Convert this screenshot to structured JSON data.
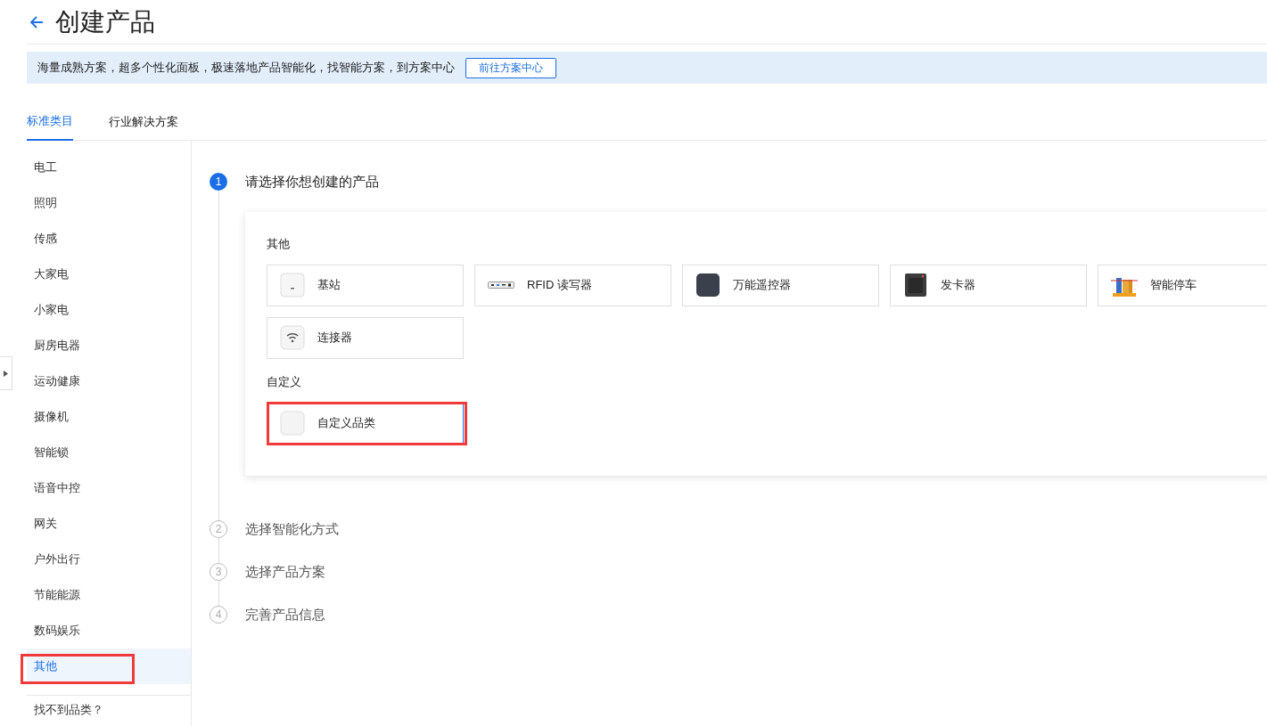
{
  "header": {
    "title": "创建产品"
  },
  "banner": {
    "text": "海量成熟方案，超多个性化面板，极速落地产品智能化，找智能方案，到方案中心",
    "button": "前往方案中心"
  },
  "tabs": [
    {
      "label": "标准类目",
      "selected": true
    },
    {
      "label": "行业解决方案",
      "selected": false
    }
  ],
  "sidebar": {
    "items": [
      {
        "label": "电工",
        "selected": false,
        "highlighted": false
      },
      {
        "label": "照明",
        "selected": false,
        "highlighted": false
      },
      {
        "label": "传感",
        "selected": false,
        "highlighted": false
      },
      {
        "label": "大家电",
        "selected": false,
        "highlighted": false
      },
      {
        "label": "小家电",
        "selected": false,
        "highlighted": false
      },
      {
        "label": "厨房电器",
        "selected": false,
        "highlighted": false
      },
      {
        "label": "运动健康",
        "selected": false,
        "highlighted": false
      },
      {
        "label": "摄像机",
        "selected": false,
        "highlighted": false
      },
      {
        "label": "智能锁",
        "selected": false,
        "highlighted": false
      },
      {
        "label": "语音中控",
        "selected": false,
        "highlighted": false
      },
      {
        "label": "网关",
        "selected": false,
        "highlighted": false
      },
      {
        "label": "户外出行",
        "selected": false,
        "highlighted": false
      },
      {
        "label": "节能能源",
        "selected": false,
        "highlighted": false
      },
      {
        "label": "数码娱乐",
        "selected": false,
        "highlighted": false
      },
      {
        "label": "其他",
        "selected": true,
        "highlighted": true
      }
    ],
    "footer_link": "找不到品类？"
  },
  "steps": [
    {
      "number": "1",
      "label": "请选择你想创建的产品",
      "active": true
    },
    {
      "number": "2",
      "label": "选择智能化方式",
      "active": false
    },
    {
      "number": "3",
      "label": "选择产品方案",
      "active": false
    },
    {
      "number": "4",
      "label": "完善产品信息",
      "active": false
    }
  ],
  "groups": [
    {
      "title": "其他",
      "products": [
        {
          "label": "基站",
          "kind": "base-station",
          "selected": false,
          "highlighted": false
        },
        {
          "label": "RFID 读写器",
          "kind": "rfid-reader",
          "selected": false,
          "highlighted": false
        },
        {
          "label": "万能遥控器",
          "kind": "remote",
          "selected": false,
          "highlighted": false
        },
        {
          "label": "发卡器",
          "kind": "card-reader",
          "selected": false,
          "highlighted": false
        },
        {
          "label": "智能停车",
          "kind": "parking",
          "selected": false,
          "highlighted": false
        },
        {
          "label": "连接器",
          "kind": "wifi",
          "selected": false,
          "highlighted": false
        }
      ]
    },
    {
      "title": "自定义",
      "products": [
        {
          "label": "自定义品类",
          "kind": "blank",
          "selected": true,
          "highlighted": true
        }
      ]
    }
  ]
}
